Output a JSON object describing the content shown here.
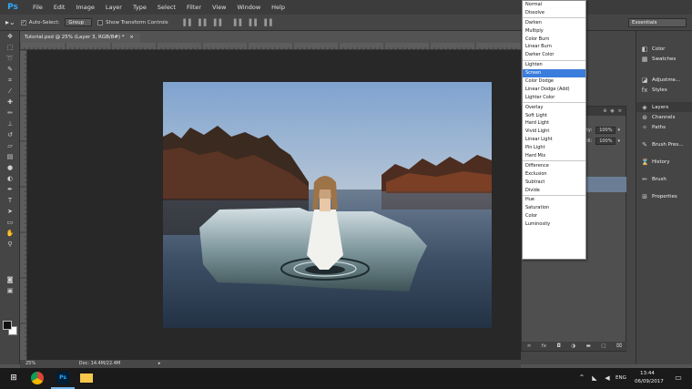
{
  "menu": [
    "File",
    "Edit",
    "Image",
    "Layer",
    "Type",
    "Select",
    "Filter",
    "View",
    "Window",
    "Help"
  ],
  "app_logo": "Ps",
  "options": {
    "auto_select_label": "Auto-Select:",
    "group_value": "Group",
    "show_transform_label": "Show Transform Controls"
  },
  "workspace": "Essentials",
  "document_tab": "Tutorial.psd @ 25% (Layer 3, RGB/8#) *",
  "document_close": "×",
  "status": {
    "zoom": "25%",
    "doc": "Doc: 14.4M/22.4M"
  },
  "blend_groups": [
    [
      "Normal",
      "Dissolve"
    ],
    [
      "Darken",
      "Multiply",
      "Color Burn",
      "Linear Burn",
      "Darker Color"
    ],
    [
      "Lighten",
      "Screen",
      "Color Dodge",
      "Linear Dodge (Add)",
      "Lighter Color"
    ],
    [
      "Overlay",
      "Soft Light",
      "Hard Light",
      "Vivid Light",
      "Linear Light",
      "Pin Light",
      "Hard Mix"
    ],
    [
      "Difference",
      "Exclusion",
      "Subtract",
      "Divide"
    ],
    [
      "Hue",
      "Saturation",
      "Color",
      "Luminosity"
    ]
  ],
  "blend_selected": "Screen",
  "layers": {
    "opacity_label": "pacity:",
    "opacity_value": "100%",
    "fill_label": "Fill:",
    "fill_value": "100%"
  },
  "panels": [
    {
      "name": "Color",
      "icon": "color-icon"
    },
    {
      "name": "Swatches",
      "icon": "swatches-icon"
    },
    {
      "name": "Adjustme...",
      "icon": "adjustments-icon"
    },
    {
      "name": "Styles",
      "icon": "styles-icon"
    },
    {
      "name": "Layers",
      "icon": "layers-icon"
    },
    {
      "name": "Channels",
      "icon": "channels-icon"
    },
    {
      "name": "Paths",
      "icon": "paths-icon"
    },
    {
      "name": "Brush Pres...",
      "icon": "brush-presets-icon"
    },
    {
      "name": "History",
      "icon": "history-icon"
    },
    {
      "name": "Brush",
      "icon": "brush-icon"
    },
    {
      "name": "Properties",
      "icon": "properties-icon"
    }
  ],
  "taskbar": {
    "language": "ENG",
    "time": "13:44",
    "date": "06/09/2017"
  },
  "colors": {
    "accent": "#3b7ddd",
    "ps_blue": "#31a8ff",
    "ui_dark": "#454545"
  }
}
